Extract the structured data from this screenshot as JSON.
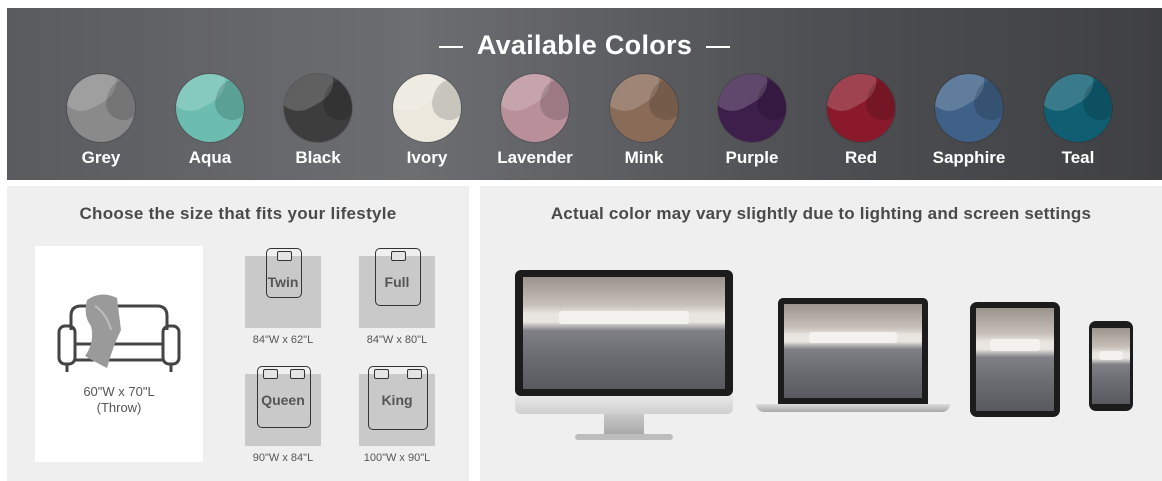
{
  "colors": {
    "title": "Available Colors",
    "swatches": [
      {
        "label": "Grey",
        "color": "#8a8a8a"
      },
      {
        "label": "Aqua",
        "color": "#6cbdb0"
      },
      {
        "label": "Black",
        "color": "#3d3d3d"
      },
      {
        "label": "Ivory",
        "color": "#ece8de"
      },
      {
        "label": "Lavender",
        "color": "#b9909a"
      },
      {
        "label": "Mink",
        "color": "#8a6b57"
      },
      {
        "label": "Purple",
        "color": "#3e1f4c"
      },
      {
        "label": "Red",
        "color": "#8a1a2b"
      },
      {
        "label": "Sapphire",
        "color": "#3f6188"
      },
      {
        "label": "Teal",
        "color": "#0f5e72"
      }
    ]
  },
  "sizes": {
    "title": "Choose the size that fits your lifestyle",
    "throw": {
      "dims": "60\"W x 70\"L",
      "name": "(Throw)"
    },
    "beds": [
      {
        "name": "Twin",
        "dims": "84\"W x 62\"L"
      },
      {
        "name": "Full",
        "dims": "84\"W x 80\"L"
      },
      {
        "name": "Queen",
        "dims": "90\"W x 84\"L"
      },
      {
        "name": "King",
        "dims": "100\"W x 90\"L"
      }
    ]
  },
  "devices": {
    "title": "Actual color may vary slightly due to lighting and screen settings",
    "items": [
      "desktop-monitor",
      "laptop",
      "tablet",
      "phone"
    ]
  }
}
